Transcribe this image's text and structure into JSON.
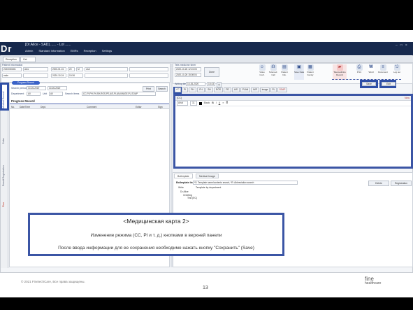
{
  "app": {
    "logo": "Dr",
    "window_title": "[Dr.Alice - SAD] ...... - Lot ......",
    "menu": [
      "Admin",
      "Standard Information",
      "EMRs",
      "Reception",
      "Settings"
    ],
    "tabs": [
      "Reception",
      "Cat"
    ]
  },
  "patient_info": {
    "label": "Patient Information",
    "id": "2020000281",
    "name": "Alex",
    "gender": "male",
    "dob1": "2000-01-01",
    "dob2": "2020-10-24",
    "age": "20",
    "visit": "M",
    "time": "15:36",
    "status": "visit"
  },
  "rail": {
    "item1": "Medical Record",
    "item2": "Order",
    "item3": "Result Registration",
    "item4": "Plan"
  },
  "progress": {
    "pill": "Progress Record",
    "search_period_label": "Search period",
    "date_from": "10-26-2019",
    "date_to": "10-26-2020",
    "department_label": "Department",
    "department_value": "All",
    "unit_label": "Unit",
    "unit_value": "All",
    "search_items_label": "Search items",
    "search_items_value": "CC,PI,PH,FH,SH,ROS,PE,A/S,PLAN,IMAGE,PL,SOAP",
    "print_button": "Print",
    "search_button": "Search",
    "section_title": "Progress Record",
    "columns": [
      "No.",
      "Date/Time",
      "Dept.",
      "Comment",
      "Editor",
      "Sign"
    ]
  },
  "stamp": {
    "label": "Tele-medicine timer",
    "start": "2020-10-26 12:15:05",
    "end": "2020-10-26 15:08:04",
    "button": "Done"
  },
  "toolbar": {
    "items": [
      {
        "icon": "people-icon",
        "label": "Video Conf."
      },
      {
        "icon": "headset-icon",
        "label": "Telemed. Call"
      },
      {
        "icon": "file-icon",
        "label": "Patient Info."
      },
      {
        "icon": "save-icon",
        "label": "Save Data"
      },
      {
        "icon": "record-icon",
        "label": "Patient Family"
      },
      {
        "icon": "folder-icon",
        "label": "Telemedicine Record"
      },
      {
        "icon": "print-icon",
        "label": "Print"
      },
      {
        "icon": "w-icon",
        "label": "Word"
      },
      {
        "icon": "doc-icon",
        "label": "Document"
      },
      {
        "icon": "exit-icon",
        "label": "Log out"
      }
    ]
  },
  "editor": {
    "writing_time_label": "Writing time",
    "writing_date": "10-26-2020",
    "writing_time": "15:43",
    "cc_tabs": [
      "CC",
      "PI",
      "PH",
      "FH",
      "SH",
      "ROS",
      "PE",
      "A/S",
      "PLAN",
      "IMP",
      "Image",
      "PL",
      "SOAP"
    ],
    "header": "[CC]",
    "header_right": "Now",
    "font_name": "Arial",
    "font_size": "11",
    "color_label": "Black",
    "save_button": "Save",
    "edit_button": "Edit"
  },
  "boilerplate": {
    "tabs": [
      "Boilerplate",
      "Medical Image"
    ],
    "title": "Boilerplate list",
    "hint": "*S: Template name/contents search, *R: Abbreviation search",
    "col_write": "Write",
    "template_by": "Template by department",
    "tree": [
      "Dr.Alice",
      "Greeting",
      "Test (EC)"
    ],
    "delete_button": "Delete",
    "register_button": "Registration"
  },
  "callout": {
    "title": "<Медицинская карта 2>",
    "line1": "Изменение режима (CC, PI и т. д.) кнопками в верхней панели",
    "line2": "После ввода информации для ее сохранения необходимо нажать кнопку \"Сохранить\" (Save)"
  },
  "footer": {
    "copyright": "© 2021 FinetechCare, Все права защищены.",
    "page": "13",
    "brand_line1": "fine",
    "brand_line2": "healthcare"
  },
  "colors": {
    "titlebar": "#17294d",
    "highlight": "#2f4fa6",
    "accent_pill": "#3a62c7"
  }
}
